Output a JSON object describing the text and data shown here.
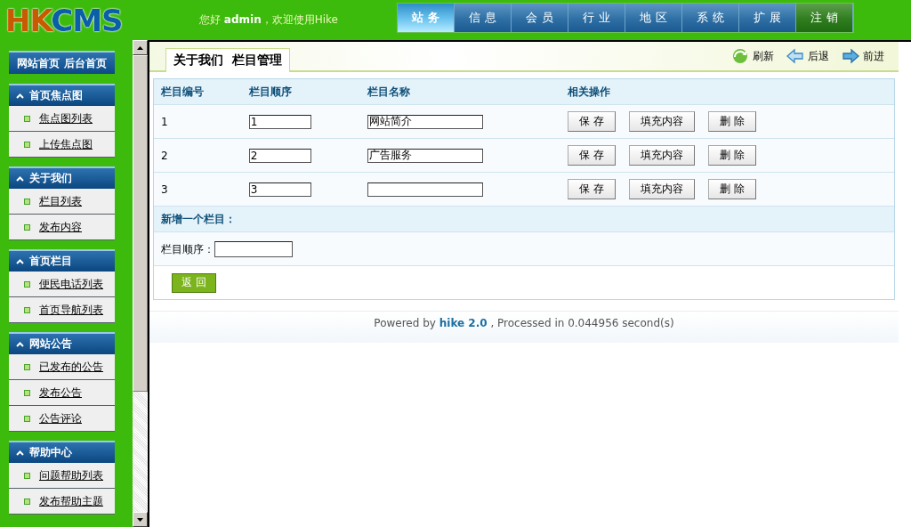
{
  "header": {
    "logo": "HKCMS",
    "greeting": "您好 **admin**，欢迎使用Hike"
  },
  "nav": [
    {
      "label": "站 务",
      "kind": "section",
      "selected": true
    },
    {
      "label": "信 息",
      "kind": "section",
      "selected": false
    },
    {
      "label": "会 员",
      "kind": "section",
      "selected": false
    },
    {
      "label": "行 业",
      "kind": "section",
      "selected": false
    },
    {
      "label": "地 区",
      "kind": "section",
      "selected": false
    },
    {
      "label": "系 统",
      "kind": "section",
      "selected": false
    },
    {
      "label": "扩 展",
      "kind": "section",
      "selected": false
    },
    {
      "label": "注 销",
      "kind": "logout",
      "selected": false
    }
  ],
  "sidebar": {
    "home_links": "网站首页 后台首页",
    "groups": [
      {
        "title": "首页焦点图",
        "expanded": true,
        "items": [
          "焦点图列表",
          "上传焦点图"
        ]
      },
      {
        "title": "关于我们",
        "expanded": true,
        "items": [
          "栏目列表",
          "发布内容"
        ]
      },
      {
        "title": "首页栏目",
        "expanded": true,
        "items": [
          "便民电话列表",
          "首页导航列表"
        ]
      },
      {
        "title": "网站公告",
        "expanded": true,
        "items": [
          "已发布的公告",
          "发布公告",
          "公告评论"
        ]
      },
      {
        "title": "帮助中心",
        "expanded": true,
        "items": [
          "问题帮助列表",
          "发布帮助主题"
        ]
      }
    ]
  },
  "main": {
    "tab": "关于我们  栏目管理",
    "actions": [
      {
        "label": "刷新",
        "kind": "refresh"
      },
      {
        "label": "后退",
        "kind": "back"
      },
      {
        "label": "前进",
        "kind": "forward"
      }
    ],
    "table": {
      "columns": [
        "栏目编号",
        "栏目顺序",
        "栏目名称",
        "相关操作"
      ],
      "rows": [
        {
          "id": "1",
          "order": "1",
          "name": "网站简介",
          "buttons": [
            "保 存",
            "填充内容",
            "删 除"
          ]
        },
        {
          "id": "2",
          "order": "2",
          "name": "广告服务",
          "buttons": [
            "保 存",
            "填充内容",
            "删 除"
          ]
        },
        {
          "id": "3",
          "order": "3",
          "name": "",
          "buttons": [
            "保 存",
            "填充内容",
            "删 除"
          ]
        }
      ]
    },
    "add_section": {
      "title": "新增一个栏目：",
      "order_label": "栏目顺序："
    },
    "back_button": "返 回"
  },
  "footer": "Powered by **hike 2.0** , Processed in 0.044956 second(s)"
}
